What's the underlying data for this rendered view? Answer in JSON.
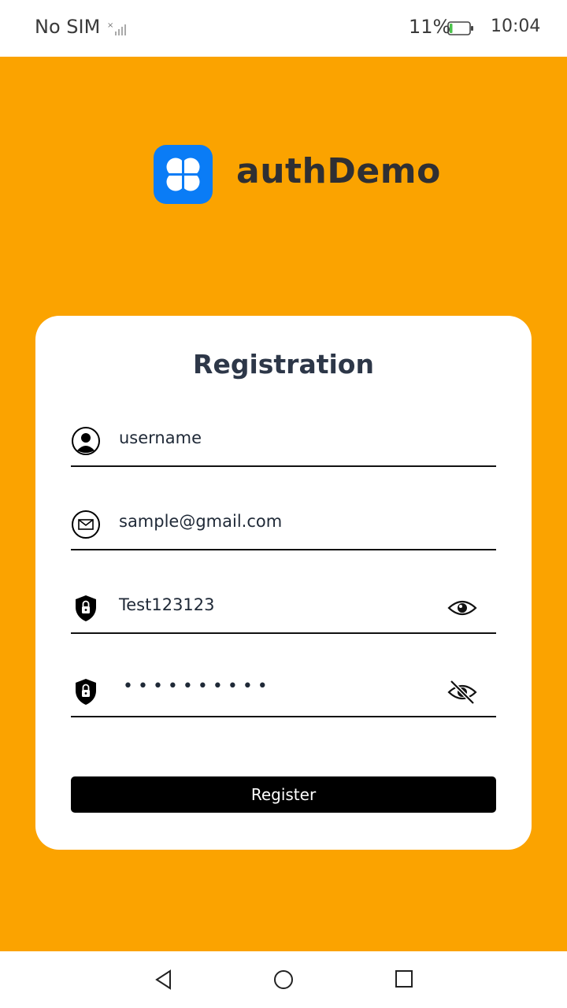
{
  "status_bar": {
    "carrier": "No SIM",
    "battery_percent": "11%",
    "battery_level": 0.11,
    "time": "10:04",
    "icons": [
      "signal-icon",
      "battery-icon"
    ]
  },
  "app": {
    "name": "authDemo",
    "icon": "app-logo-icon",
    "brand_color": "#0A7CF6",
    "background_color": "#FBA300"
  },
  "form": {
    "title": "Registration",
    "fields": [
      {
        "icon": "user-icon",
        "value": "username"
      },
      {
        "icon": "mail-icon",
        "value": "sample@gmail.com"
      },
      {
        "icon": "shield-lock-icon",
        "value": "Test123123",
        "trailing_icon": "eye-icon"
      },
      {
        "icon": "shield-lock-icon",
        "masked_value": "••••••••••",
        "trailing_icon": "eye-off-icon"
      }
    ],
    "submit_label": "Register"
  },
  "nav_bar": {
    "icons": [
      "back-icon",
      "home-icon",
      "recent-apps-icon"
    ]
  }
}
